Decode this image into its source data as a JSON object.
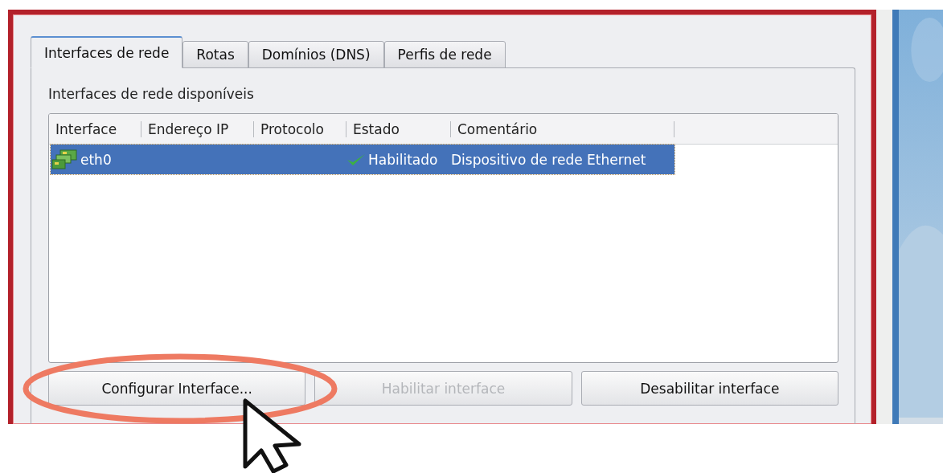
{
  "tabs": [
    {
      "label": "Interfaces de rede",
      "selected": true
    },
    {
      "label": "Rotas",
      "selected": false
    },
    {
      "label": "Domínios (DNS)",
      "selected": false
    },
    {
      "label": "Perfis de rede",
      "selected": false
    }
  ],
  "group_label": "Interfaces de rede disponíveis",
  "table": {
    "columns": [
      "Interface",
      "Endereço IP",
      "Protocolo",
      "Estado",
      "Comentário"
    ],
    "rows": [
      {
        "interface": "eth0",
        "status": "Habilitado",
        "enabled": true,
        "comment": "Dispositivo de rede Ethernet",
        "selected": true
      }
    ]
  },
  "buttons": [
    {
      "label": "Configurar Interface...",
      "disabled": false,
      "highlighted": true
    },
    {
      "label": "Habilitar interface",
      "disabled": true,
      "highlighted": false
    },
    {
      "label": "Desabilitar interface",
      "disabled": false,
      "highlighted": false
    }
  ]
}
